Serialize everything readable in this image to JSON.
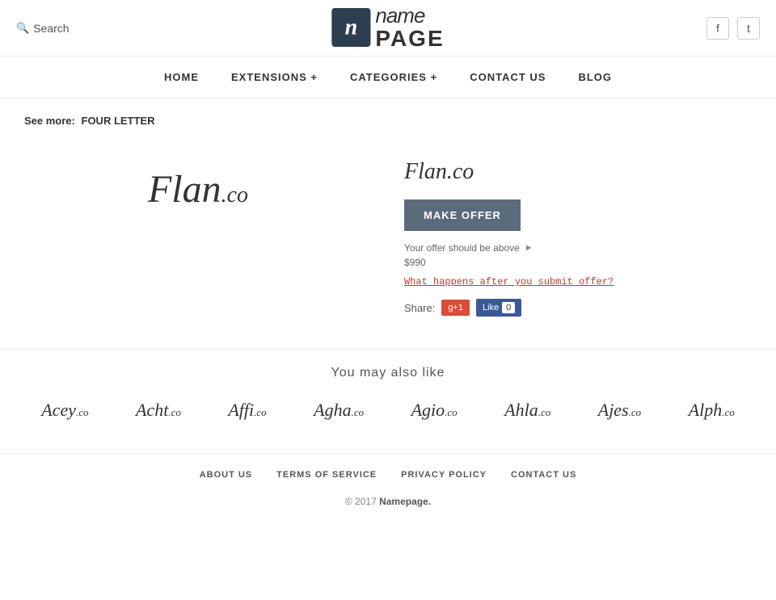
{
  "header": {
    "search_label": "Search",
    "logo_icon": "n",
    "logo_name": "name",
    "logo_page": "PAGE",
    "facebook_label": "f",
    "twitter_label": "t"
  },
  "nav": {
    "items": [
      {
        "id": "home",
        "label": "HOME"
      },
      {
        "id": "extensions",
        "label": "EXTENSIONS +"
      },
      {
        "id": "categories",
        "label": "CATEGORIES +"
      },
      {
        "id": "contact",
        "label": "CONTACT US"
      },
      {
        "id": "blog",
        "label": "BLOG"
      }
    ]
  },
  "breadcrumb": {
    "prefix": "See more:",
    "link_text": "FOUR LETTER"
  },
  "domain": {
    "name": "Flan",
    "tld": ".co",
    "full": "Flan.co",
    "make_offer_label": "Make Offer",
    "offer_info": "Your offer should be above",
    "offer_price": "$990",
    "what_happens": "What happens after you submit offer?",
    "share_label": "Share:",
    "gplus_label": "g+1",
    "fb_like_label": "Like",
    "fb_count": "0"
  },
  "also_like": {
    "title": "You may also like",
    "domains": [
      {
        "name": "Acey",
        "tld": ".co"
      },
      {
        "name": "Acht",
        "tld": ".co"
      },
      {
        "name": "Affi",
        "tld": ".co"
      },
      {
        "name": "Agha",
        "tld": ".co"
      },
      {
        "name": "Agio",
        "tld": ".co"
      },
      {
        "name": "Ahla",
        "tld": ".co"
      },
      {
        "name": "Ajes",
        "tld": ".co"
      },
      {
        "name": "Alph",
        "tld": ".co"
      }
    ]
  },
  "footer": {
    "nav_items": [
      {
        "id": "about",
        "label": "ABOUT US"
      },
      {
        "id": "terms",
        "label": "TERMS OF SERVICE"
      },
      {
        "id": "privacy",
        "label": "PRIVACY POLICY"
      },
      {
        "id": "contact",
        "label": "CONTACT US"
      }
    ],
    "copy_prefix": "© 2017",
    "copy_brand": "Namepage.",
    "copy_suffix": ""
  }
}
